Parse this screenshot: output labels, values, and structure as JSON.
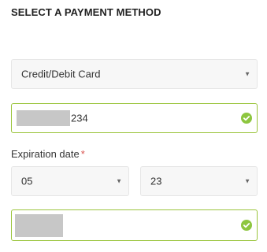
{
  "title": "SELECT A PAYMENT METHOD",
  "payment_method": {
    "selected": "Credit/Debit Card",
    "caret": "▼"
  },
  "card_number": {
    "visible_suffix": "234",
    "status_icon": "check-circle-icon",
    "valid_color": "#8dc63f"
  },
  "expiration": {
    "label": "Expiration date",
    "required_marker": "*",
    "month": "05",
    "year": "23",
    "caret": "▼"
  },
  "security_code": {
    "status_icon": "check-circle-icon"
  },
  "colors": {
    "valid_border": "#9bc53d",
    "required": "#d9534f"
  }
}
